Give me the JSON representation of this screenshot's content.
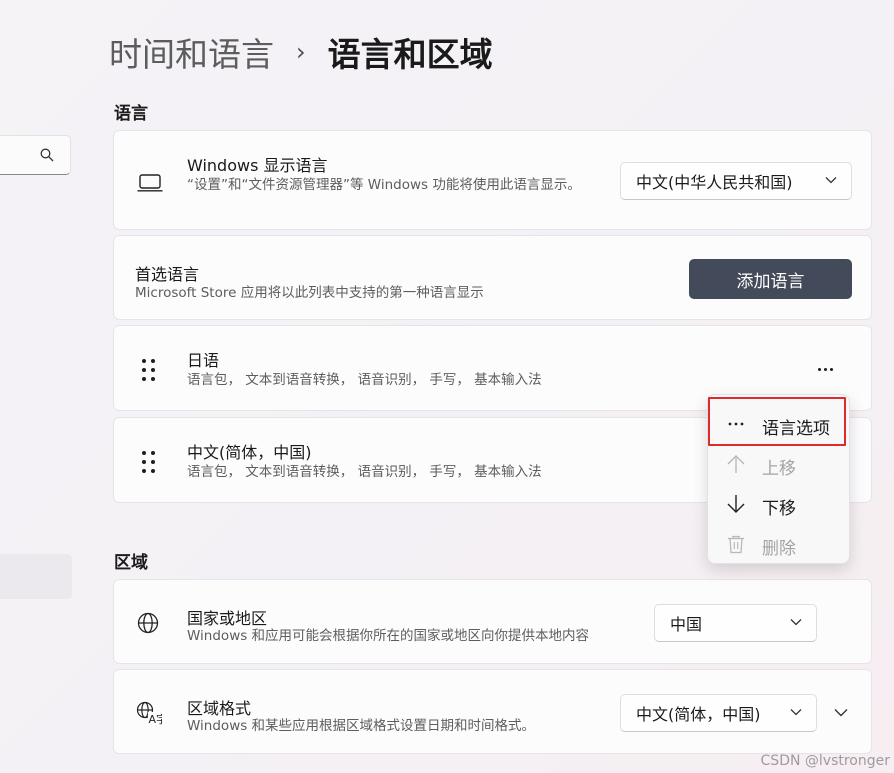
{
  "breadcrumb": {
    "parent": "时间和语言",
    "separator": "›",
    "current": "语言和区域"
  },
  "sections": {
    "language": "语言",
    "region": "区域"
  },
  "display_language": {
    "title": "Windows 显示语言",
    "description": "“设置”和“文件资源管理器”等 Windows 功能将使用此语言显示。",
    "selected": "中文(中华人民共和国)"
  },
  "preferred_languages": {
    "title": "首选语言",
    "description": "Microsoft Store 应用将以此列表中支持的第一种语言显示",
    "add_button": "添加语言",
    "items": [
      {
        "name": "日语",
        "features": "语言包， 文本到语音转换， 语音识别， 手写， 基本输入法"
      },
      {
        "name": "中文(简体，中国)",
        "features": "语言包， 文本到语音转换， 语音识别， 手写， 基本输入法"
      }
    ]
  },
  "context_menu": {
    "items": [
      {
        "label": "语言选项",
        "icon": "more-icon",
        "enabled": true
      },
      {
        "label": "上移",
        "icon": "arrow-up-icon",
        "enabled": false
      },
      {
        "label": "下移",
        "icon": "arrow-down-icon",
        "enabled": true
      },
      {
        "label": "删除",
        "icon": "trash-icon",
        "enabled": false
      }
    ],
    "highlight_color": "#dd2b2b"
  },
  "country": {
    "title": "国家或地区",
    "description": "Windows 和应用可能会根据你所在的国家或地区向你提供本地内容",
    "selected": "中国"
  },
  "regional_format": {
    "title": "区域格式",
    "description": "Windows 和某些应用根据区域格式设置日期和时间格式。",
    "selected": "中文(简体，中国)"
  },
  "watermark": "CSDN @lvstronger",
  "colors": {
    "accent_button": "#434b5a"
  }
}
